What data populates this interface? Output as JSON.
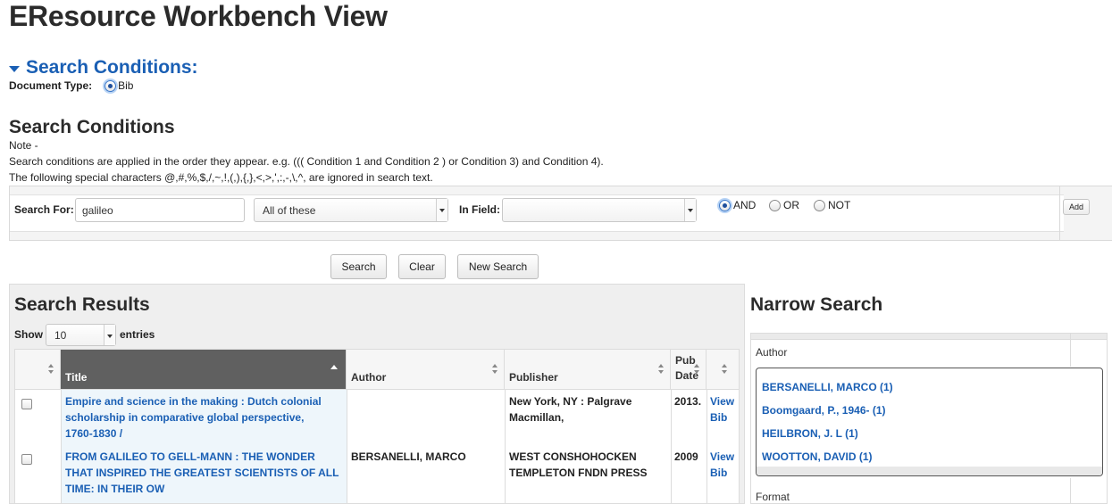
{
  "page": {
    "title": "EResource Workbench View"
  },
  "search_conditions_toggle": {
    "label": "Search Conditions:"
  },
  "document_type": {
    "label": "Document Type:",
    "value": "Bib"
  },
  "search_conditions": {
    "heading": "Search Conditions",
    "note_label": "Note -",
    "note_line1": "Search conditions are applied in the order they appear. e.g. ((( Condition 1 and Condition 2 ) or Condition 3) and Condition 4).",
    "note_line2": "The following special characters @,#,%,$,/,~,!,(,),{,},<,>,',:,-,\\,^, are ignored in search text.",
    "search_for_label": "Search For:",
    "search_for_value": "galileo",
    "match_select": "All of these",
    "in_field_label": "In Field:",
    "in_field_value": "",
    "operators": [
      {
        "label": "AND",
        "selected": true
      },
      {
        "label": "OR",
        "selected": false
      },
      {
        "label": "NOT",
        "selected": false
      }
    ],
    "add_label": "Add"
  },
  "actions": {
    "search": "Search",
    "clear": "Clear",
    "new_search": "New Search"
  },
  "results": {
    "heading": "Search Results",
    "show_label": "Show",
    "page_size": "10",
    "entries_label": "entries",
    "columns": [
      "Title",
      "Author",
      "Publisher",
      "Pub Date"
    ],
    "pub_date_line1": "Pub",
    "pub_date_line2": "Date",
    "rows": [
      {
        "title_lines": [
          "Empire and science in the making : Dutch colonial",
          "scholarship in comparative global perspective,",
          "1760-1830 /"
        ],
        "author": "",
        "publisher_lines": [
          "New York, NY : Palgrave",
          "Macmillan,"
        ],
        "pub_date": "2013.",
        "view": "View",
        "bib": "Bib"
      },
      {
        "title_lines": [
          "FROM GALILEO TO GELL-MANN : THE WONDER",
          "THAT INSPIRED THE GREATEST SCIENTISTS OF ALL",
          "TIME: IN THEIR OW"
        ],
        "author": "BERSANELLI, MARCO",
        "publisher_lines": [
          "WEST CONSHOHOCKEN",
          "TEMPLETON FNDN PRESS"
        ],
        "pub_date": "2009",
        "view": "View",
        "bib": "Bib"
      }
    ]
  },
  "narrow": {
    "heading": "Narrow Search",
    "author_label": "Author",
    "authors": [
      "BERSANELLI, MARCO (1)",
      "Boomgaard, P., 1946- (1)",
      "HEILBRON, J. L (1)",
      "WOOTTON, DAVID (1)"
    ],
    "format_label": "Format"
  },
  "colors": {
    "link": "#1a5fb4",
    "active_header": "#606060",
    "title_column_bg": "#eef6fb"
  }
}
